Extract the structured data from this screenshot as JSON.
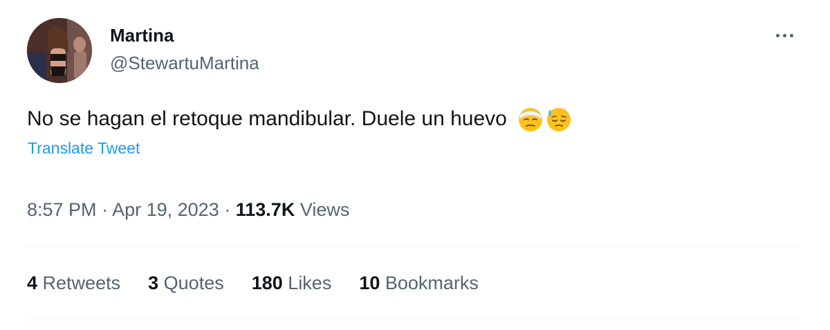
{
  "user": {
    "display_name": "Martina",
    "handle": "@StewartuMartina",
    "avatar_icon": "profile-photo"
  },
  "tweet": {
    "text": "No se hagan el retoque mandibular. Duele un huevo",
    "emojis": [
      "face-with-head-bandage-emoji",
      "downcast-face-with-sweat-emoji"
    ],
    "translate_label": "Translate Tweet"
  },
  "meta": {
    "time": "8:57 PM",
    "separator": "·",
    "date": "Apr 19, 2023",
    "views_count": "113.7K",
    "views_label": "Views"
  },
  "stats": {
    "retweets_count": "4",
    "retweets_label": "Retweets",
    "quotes_count": "3",
    "quotes_label": "Quotes",
    "likes_count": "180",
    "likes_label": "Likes",
    "bookmarks_count": "10",
    "bookmarks_label": "Bookmarks"
  },
  "colors": {
    "text_primary": "#0f1419",
    "text_secondary": "#536471",
    "link": "#1d9bf0",
    "divider": "#eff3f4"
  }
}
